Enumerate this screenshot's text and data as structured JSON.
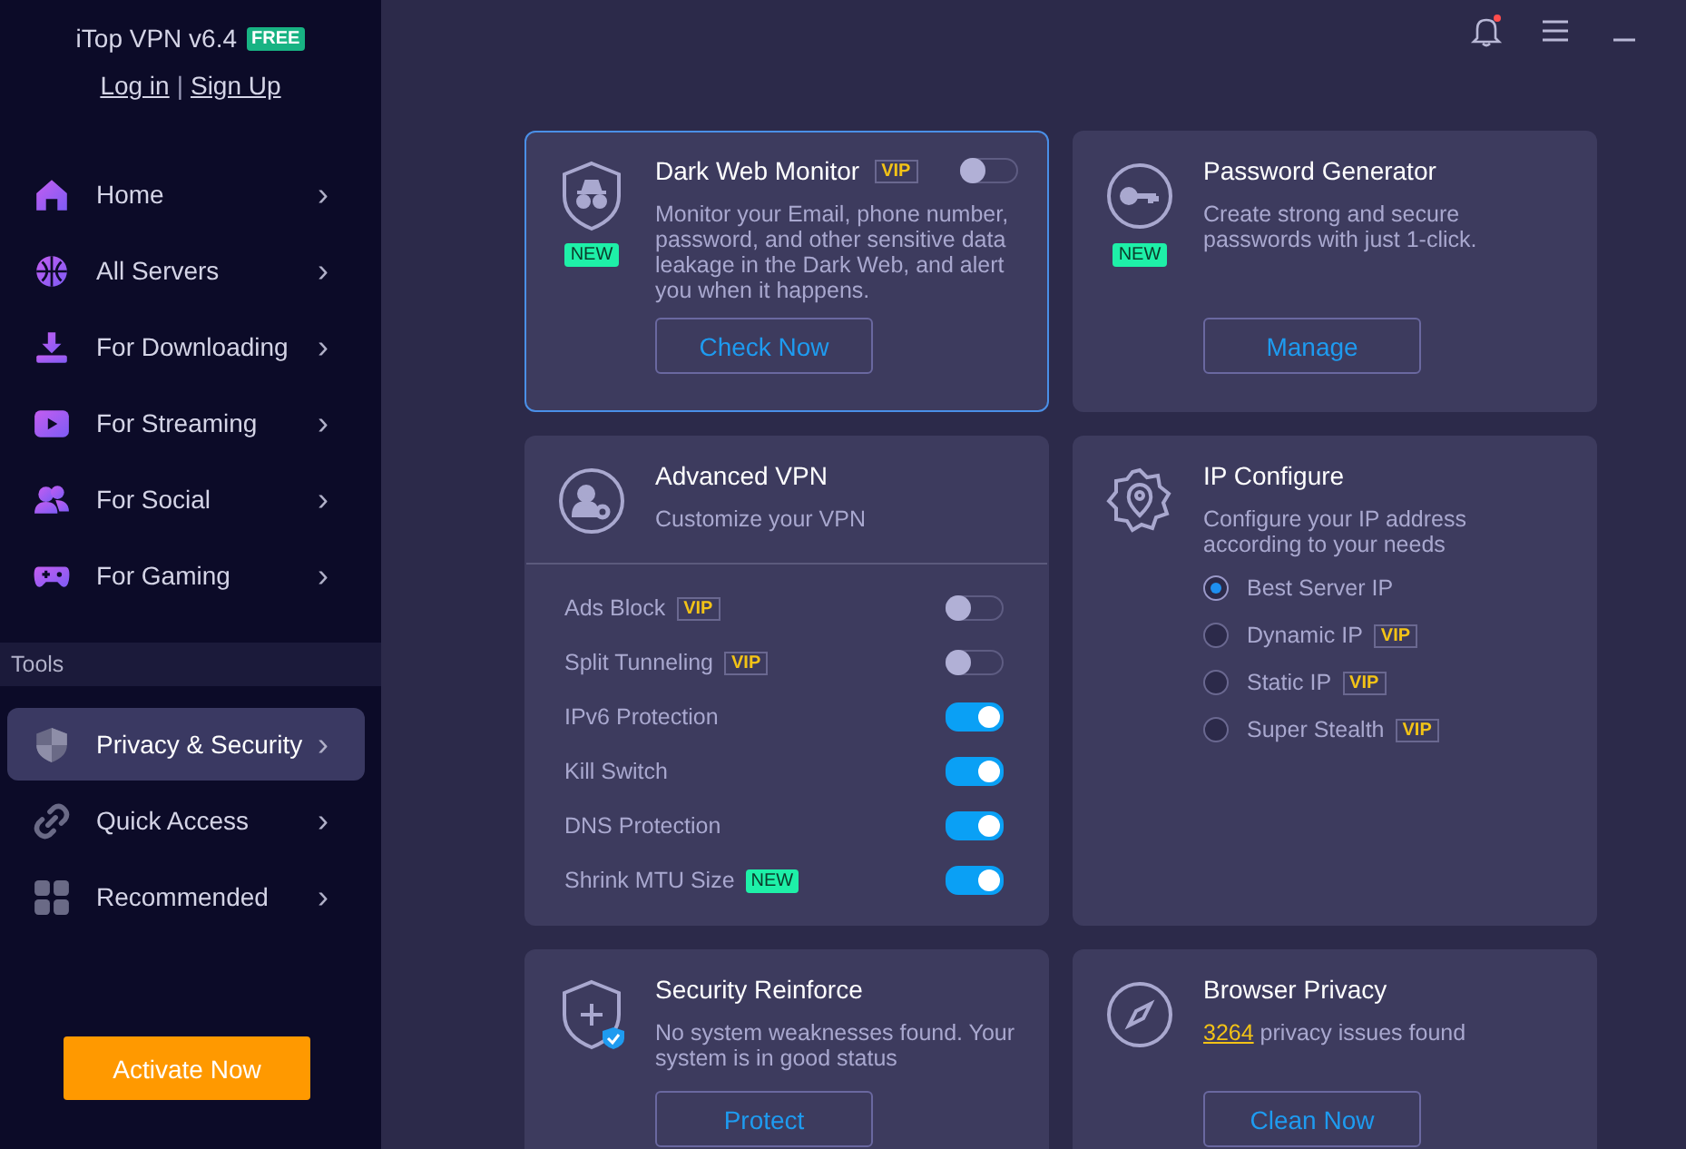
{
  "sidebar": {
    "app_title": "iTop VPN v6.4",
    "plan_badge": "FREE",
    "login_link": "Log in",
    "separator": "|",
    "signup_link": "Sign Up",
    "nav_items": [
      {
        "label": "Home",
        "chevron": "›",
        "selected": false
      },
      {
        "label": "All Servers",
        "chevron": "›",
        "selected": false
      },
      {
        "label": "For Downloading",
        "chevron": "›",
        "selected": false
      },
      {
        "label": "For Streaming",
        "chevron": "›",
        "selected": false
      },
      {
        "label": "For Social",
        "chevron": "›",
        "selected": false
      },
      {
        "label": "For Gaming",
        "chevron": "›",
        "selected": false
      }
    ],
    "section_label": "Tools",
    "tool_items": [
      {
        "label": "Privacy & Security",
        "chevron": "›",
        "selected": true
      },
      {
        "label": "Quick Access",
        "chevron": "›",
        "selected": false
      },
      {
        "label": "Recommended",
        "chevron": "›",
        "selected": false
      }
    ],
    "activate_button": "Activate Now"
  },
  "topbar": {
    "notification_dot": true
  },
  "cards": [
    {
      "kind": "feature",
      "title": "Dark Web Monitor",
      "vip": "VIP",
      "toggle": {
        "on": false
      },
      "new_badge": "NEW",
      "highlighted": true,
      "description": "Monitor your Email, phone number, password, and other sensitive data leakage in the Dark Web, and alert you when it happens.",
      "button": "Check Now"
    },
    {
      "kind": "feature",
      "title": "Password Generator",
      "new_badge": "NEW",
      "highlighted": false,
      "description": "Create strong and secure passwords with just 1-click.",
      "button": "Manage"
    },
    {
      "kind": "settings",
      "title": "Advanced VPN",
      "highlighted": false,
      "description": "Customize your VPN",
      "settings": [
        {
          "label": "Ads Block",
          "badge": {
            "kind": "vip",
            "text": "VIP"
          },
          "on": false
        },
        {
          "label": "Split Tunneling",
          "badge": {
            "kind": "vip",
            "text": "VIP"
          },
          "on": false
        },
        {
          "label": "IPv6 Protection",
          "on": true
        },
        {
          "label": "Kill Switch",
          "on": true
        },
        {
          "label": "DNS Protection",
          "on": true
        },
        {
          "label": "Shrink MTU Size",
          "badge": {
            "kind": "new",
            "text": "NEW"
          },
          "on": true
        }
      ]
    },
    {
      "kind": "options",
      "title": "IP Configure",
      "highlighted": false,
      "description": "Configure your IP address according to your needs",
      "options": [
        {
          "label": "Best Server IP",
          "selected": true
        },
        {
          "label": "Dynamic IP",
          "badge": "VIP",
          "selected": false
        },
        {
          "label": "Static IP",
          "badge": "VIP",
          "selected": false
        },
        {
          "label": "Super Stealth",
          "badge": "VIP",
          "selected": false
        }
      ]
    },
    {
      "kind": "feature",
      "title": "Security Reinforce",
      "highlighted": false,
      "description": "No system weaknesses found. Your system is in good status",
      "button": "Protect"
    },
    {
      "kind": "feature",
      "title": "Browser Privacy",
      "highlighted": false,
      "count_link": "3264",
      "description": "privacy issues found",
      "button": "Clean Now"
    }
  ]
}
